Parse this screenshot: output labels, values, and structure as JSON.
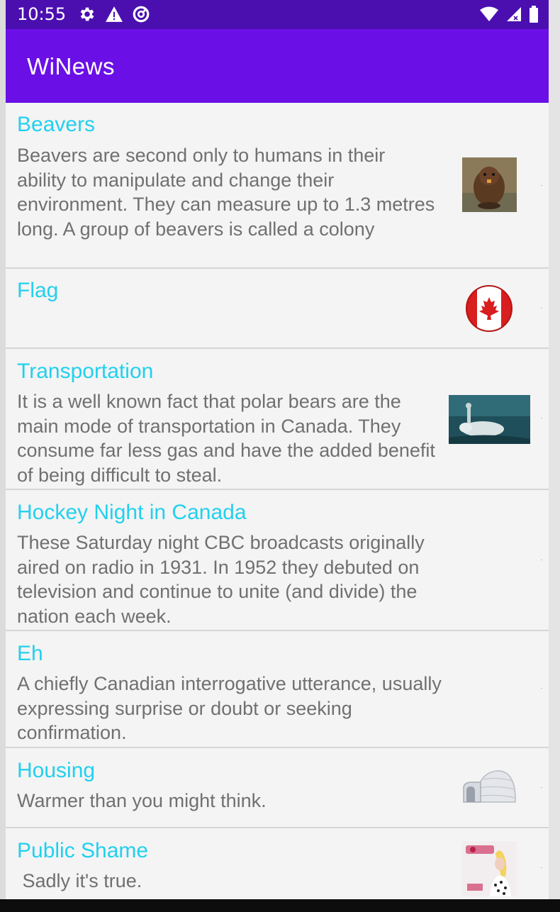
{
  "status_bar": {
    "time": "10:55",
    "icons_left": [
      "gear-icon",
      "warning-icon",
      "data-saver-icon"
    ],
    "icons_right": [
      "wifi-icon",
      "cell-signal-icon",
      "battery-icon"
    ]
  },
  "app_bar": {
    "title": "WiNews"
  },
  "colors": {
    "status_bar": "#4b0fb0",
    "app_bar": "#6a10e6",
    "title_text": "#22d0ee",
    "body_text": "#707070"
  },
  "news": [
    {
      "title": "Beavers",
      "description": "Beavers are second only to humans in their ability to manipulate and change their environment. They can measure up to 1.3 metres long. A group of beavers is called a colony",
      "image": "beaver-image"
    },
    {
      "title": "Flag",
      "description": "",
      "image": "canada-flag-image"
    },
    {
      "title": "Transportation",
      "description": "It is a well known fact that polar bears are the main mode of transportation in Canada. They consume far less gas and have the added benefit of being difficult to steal.",
      "image": "polar-bear-image"
    },
    {
      "title": "Hockey Night in Canada",
      "description": "These Saturday night CBC broadcasts originally aired on radio in 1931. In 1952 they debuted on television and continue to unite (and divide) the nation each week.",
      "image": ""
    },
    {
      "title": "Eh",
      "description": "A chiefly Canadian interrogative utterance, usually expressing surprise or doubt or seeking confirmation.",
      "image": ""
    },
    {
      "title": "Housing",
      "description": "Warmer than you might think.",
      "image": "igloo-image"
    },
    {
      "title": "Public Shame",
      "description": " Sadly it's true.",
      "image": "album-cover-image"
    }
  ]
}
